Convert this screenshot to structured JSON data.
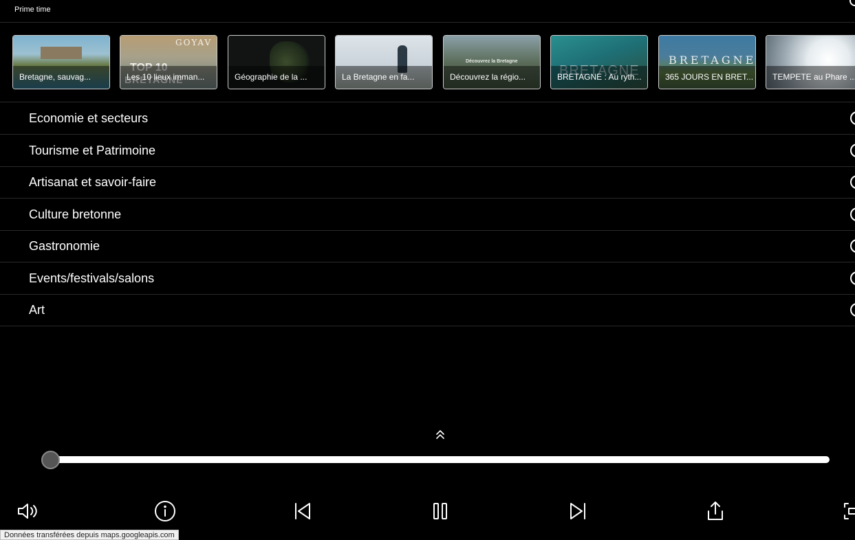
{
  "primetime": {
    "title": "Prime time"
  },
  "thumbnails": [
    {
      "caption": "Bretagne, sauvag...",
      "bg": "#3f7fa0"
    },
    {
      "caption": "Les 10 lieux imman...",
      "bg": "#8d8a7c",
      "overlay_top": "GOYAV",
      "overlay_mid": "TOP 10",
      "overlay_bottom": "BRETAGNE"
    },
    {
      "caption": "Géographie de la ...",
      "bg": "#151717"
    },
    {
      "caption": "La Bretagne en fa...",
      "bg": "#c9d3da"
    },
    {
      "caption": "Découvrez la régio...",
      "bg": "#5b6d5a",
      "overlay_top": "Découvrez la Bretagne"
    },
    {
      "caption": "BRETAGNE : Au ryth...",
      "bg": "#1e6f75",
      "overlay_mid": "BRETAGNE"
    },
    {
      "caption": "365 JOURS EN BRET...",
      "bg": "#4b7d9b",
      "overlay_top": "BRETAGNE"
    },
    {
      "caption": "TEMPETE au Phare ...",
      "bg": "#9aa7b0"
    }
  ],
  "categories": [
    "Economie et secteurs",
    "Tourisme et Patrimoine",
    "Artisanat et savoir-faire",
    "Culture bretonne",
    "Gastronomie",
    "Events/festivals/salons",
    "Art"
  ],
  "player": {
    "progress": 0
  },
  "status_bar": {
    "text": "Données transférées depuis maps.googleapis.com"
  }
}
